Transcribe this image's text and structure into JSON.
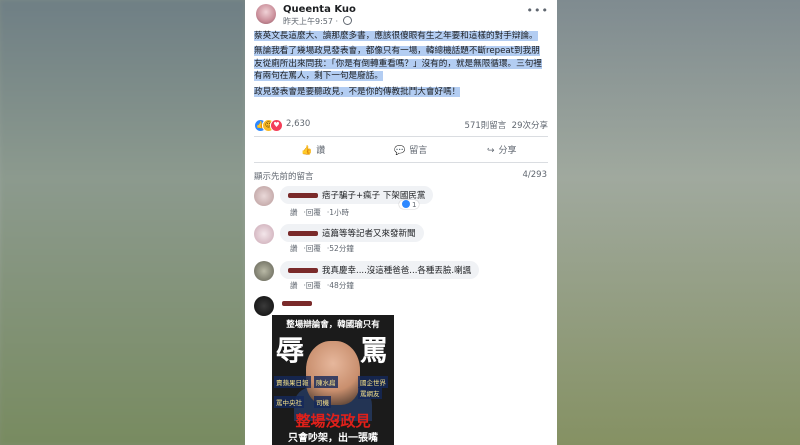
{
  "post": {
    "author": "Queenta Kuo",
    "time": "昨天上午9:57 · ",
    "paragraphs": [
      "蔡英文長這麼大、讀那麼多書，應該很傻眼有生之年要和這樣的對手辯論。",
      "無論我看了幾場政見發表會，都像只有一場，韓總機話題不斷repeat到我朋友從廁所出來問我：「你是有倒轉重看嗎？」沒有的，就是無限循環。三句裡有兩句在罵人，剩下一句是廢話。",
      "政見發表會是要聽政見，不是你的傳教批鬥大會好嗎！"
    ],
    "reaction_count": "2,630",
    "comments_count": "571則留言",
    "shares_count": "29次分享"
  },
  "actions": {
    "like": "讚",
    "comment": "留言",
    "share": "分享"
  },
  "comments_header": {
    "prev": "顯示先前的留言",
    "count": "4/293"
  },
  "comments": [
    {
      "text": "痞子騙子+瘋子 下架國民黨",
      "like": "讚",
      "reply": "回覆",
      "time": "1小時",
      "reactions": "1"
    },
    {
      "text": "這篇等等記者又來發新聞",
      "like": "讚",
      "reply": "回覆",
      "time": "52分鐘"
    },
    {
      "text": "我真慶幸....沒這種爸爸...各種丟臉.喇諷",
      "like": "讚",
      "reply": "回覆",
      "time": "48分鐘"
    }
  ],
  "poster": {
    "top": "整場辯論會，韓國瑜只有",
    "big1": "辱",
    "big2": "罵",
    "tags": [
      "賣蘋果日報",
      "陳水扁",
      "國企世界",
      "罵網友",
      "罵中央社",
      "司機"
    ],
    "red": "整場沒政見",
    "bottom": "只會吵架，出一張嘴"
  },
  "icons": {
    "more": "more-icon",
    "globe": "globe-icon",
    "like": "like-icon",
    "comment": "comment-icon",
    "share": "share-icon"
  }
}
